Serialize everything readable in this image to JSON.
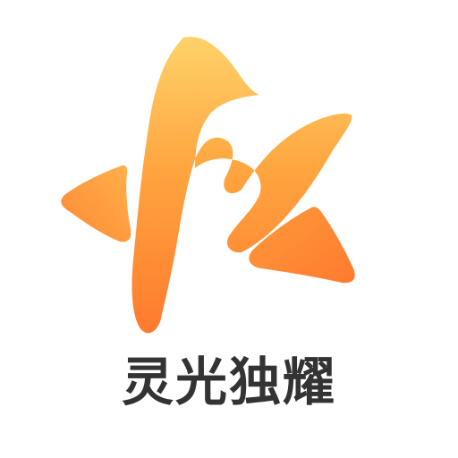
{
  "brand": {
    "name": "灵光独耀"
  },
  "logo": {
    "icon": "flame-star-logo-icon",
    "gradient_top": "#FFD26A",
    "gradient_mid": "#FFA53F",
    "gradient_bottom": "#FF7A2E"
  },
  "colors": {
    "background": "#FFFFFF",
    "text": "#333333"
  }
}
